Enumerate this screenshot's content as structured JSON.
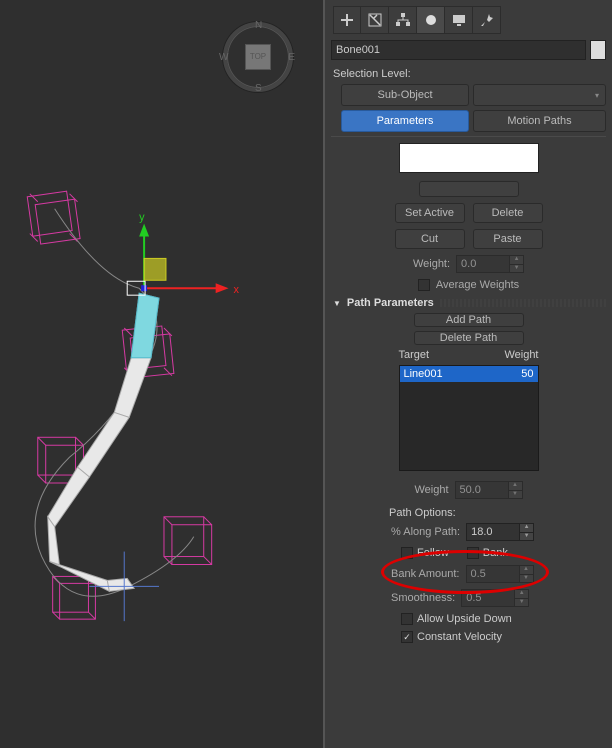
{
  "viewcube": {
    "face": "TOP",
    "N": "N",
    "S": "S",
    "E": "E",
    "W": "W"
  },
  "axes": {
    "x": "x",
    "y": "y"
  },
  "object_name": "Bone001",
  "selection_level_label": "Selection Level:",
  "buttons": {
    "sub_object": "Sub-Object",
    "parameters": "Parameters",
    "motion_paths": "Motion Paths",
    "set_active": "Set Active",
    "delete": "Delete",
    "cut": "Cut",
    "paste": "Paste",
    "add_path": "Add Path",
    "delete_path": "Delete Path"
  },
  "labels": {
    "weight": "Weight:",
    "weight2": "Weight",
    "avg_weights": "Average Weights",
    "target": "Target",
    "weight_col": "Weight",
    "path_options": "Path Options:",
    "along_path": "% Along Path:",
    "follow": "Follow",
    "bank": "Bank",
    "bank_amount": "Bank Amount:",
    "smoothness": "Smoothness:",
    "allow_upside": "Allow Upside Down",
    "const_velocity": "Constant Velocity"
  },
  "sections": {
    "path_parameters": "Path Parameters"
  },
  "values": {
    "weight_top": "0.0",
    "weight_bottom": "50.0",
    "along_path": "18.0",
    "bank_amount": "0.5",
    "smoothness": "0.5"
  },
  "list": {
    "target": "Line001",
    "weight": "50"
  },
  "checks": {
    "avg": false,
    "follow": false,
    "bank": false,
    "upside": false,
    "constv": true
  },
  "chart_data": null
}
